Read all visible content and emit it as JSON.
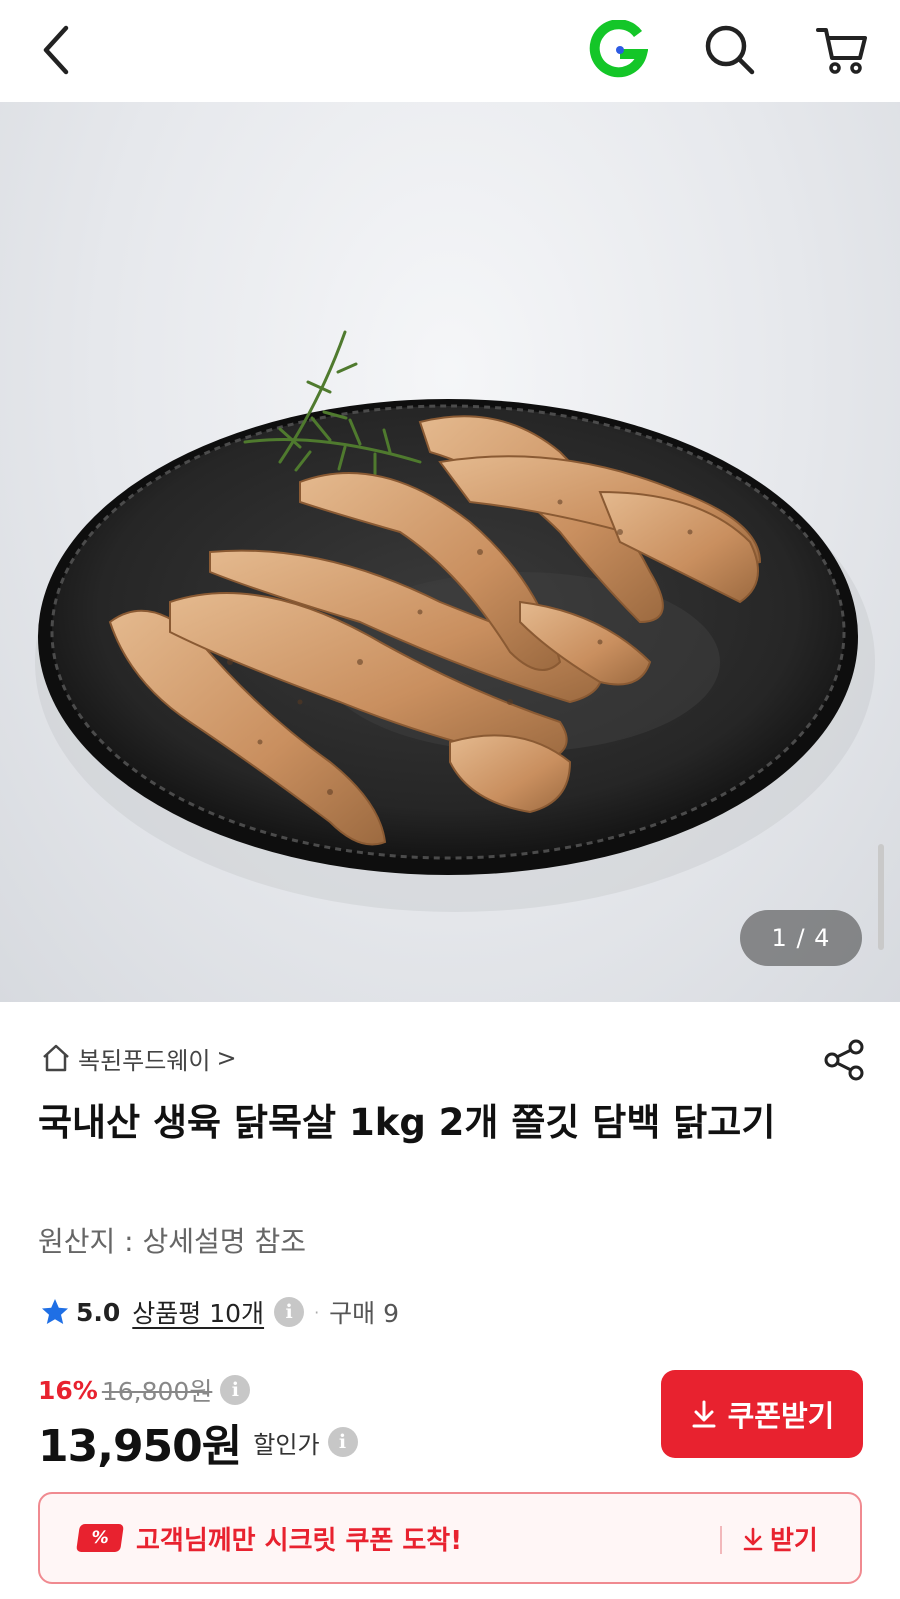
{
  "header": {
    "back_icon": "chevron-left-icon",
    "logo_letter": "G",
    "logo_color": "#14c628",
    "search_icon": "search-icon",
    "cart_icon": "cart-icon"
  },
  "gallery": {
    "counter": "1 / 4",
    "current": 1,
    "total": 4
  },
  "product": {
    "seller": "복된푸드웨이",
    "seller_arrow": ">",
    "title": "국내산 생육 닭목살 1kg 2개 쫄깃 담백 닭고기",
    "origin": "원산지 : 상세설명 참조"
  },
  "rating": {
    "score": "5.0",
    "reviews": "상품평 10개",
    "separator": "·",
    "purchases": "구매 9",
    "star_color": "#1f6fe5"
  },
  "price": {
    "discount": "16%",
    "original": "16,800원",
    "sale": "13,950원",
    "sale_label": "할인가"
  },
  "coupon": {
    "button_label": "쿠폰받기",
    "accent": "#e8222f"
  },
  "secret_coupon": {
    "badge": "%",
    "message": "고객님께만 시크릿 쿠폰 도착!",
    "action": "받기"
  }
}
